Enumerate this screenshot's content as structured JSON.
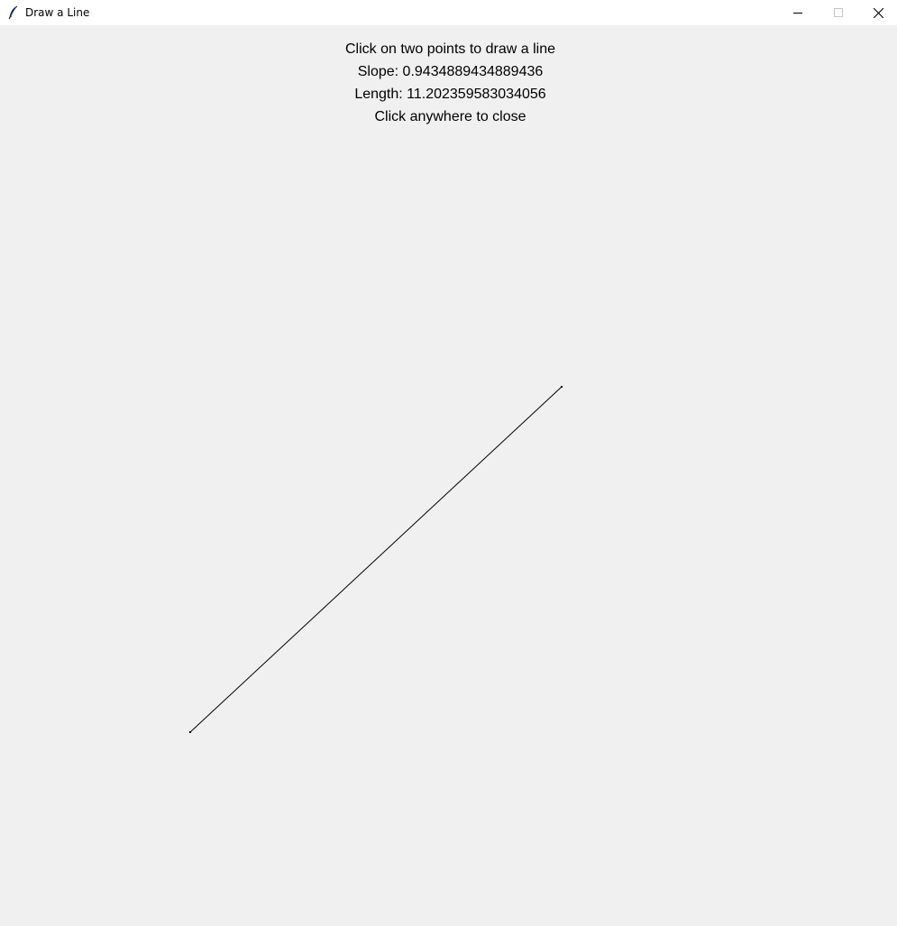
{
  "window": {
    "title": "Draw a Line",
    "icon": "feather-icon",
    "controls": {
      "minimize_icon": "minimize-icon",
      "maximize_icon": "maximize-icon",
      "close_icon": "close-icon"
    }
  },
  "labels": {
    "instruction": "Click on two points to draw a line",
    "slope": "Slope: 0.9434889434889436",
    "length": "Length: 11.202359583034056",
    "close_hint": "Click anywhere to close"
  },
  "colors": {
    "background": "#f0f0f0",
    "titlebar": "#ffffff",
    "line": "#000000"
  }
}
